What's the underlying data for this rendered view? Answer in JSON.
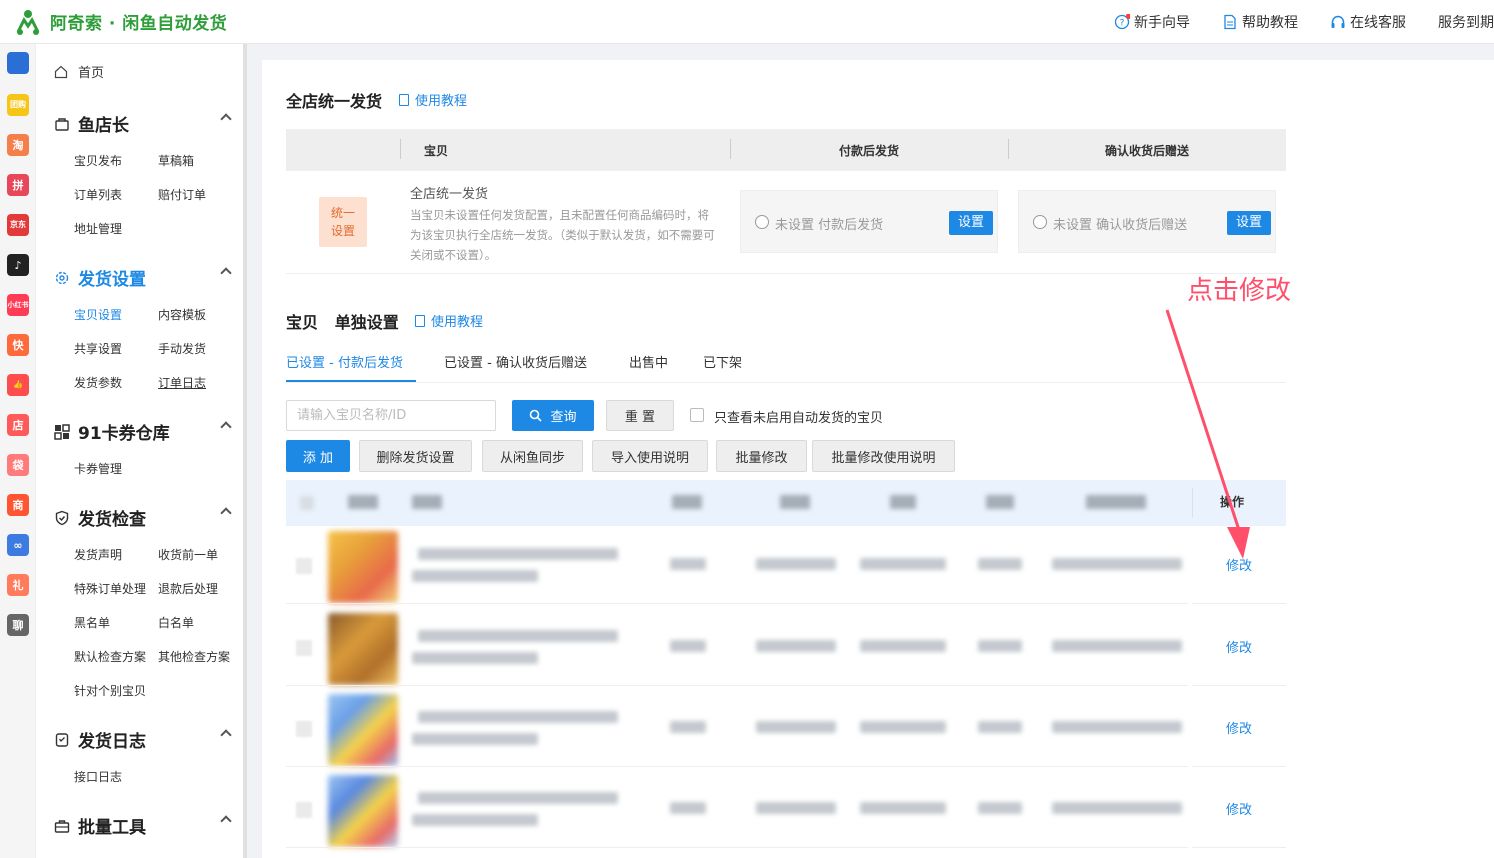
{
  "header": {
    "logo_text": "阿奇索 · 闲鱼自动发货",
    "links": [
      {
        "label": "新手向导",
        "icon": "question-circle-icon"
      },
      {
        "label": "帮助教程",
        "icon": "document-icon"
      },
      {
        "label": "在线客服",
        "icon": "headset-icon"
      },
      {
        "label": "服务到期",
        "icon": ""
      }
    ]
  },
  "app_strip": [
    {
      "name": "grid-app-icon",
      "text": "",
      "color": "#2b6fd6"
    },
    {
      "name": "tuangou-app-icon",
      "text": "团购",
      "color": "#f5c518"
    },
    {
      "name": "taobao-app-icon",
      "text": "淘",
      "color": "#f57f4b"
    },
    {
      "name": "pinduoduo-app-icon",
      "text": "拼",
      "color": "#e8475a"
    },
    {
      "name": "jingdong-app-icon",
      "text": "京东",
      "color": "#e23a3a"
    },
    {
      "name": "douyin-app-icon",
      "text": "♪",
      "color": "#222222"
    },
    {
      "name": "xiaohongshu-app-icon",
      "text": "小红书",
      "color": "#ff3b56"
    },
    {
      "name": "kuaishou-app-icon",
      "text": "快",
      "color": "#ff6a3c"
    },
    {
      "name": "thumb-app-icon",
      "text": "👍",
      "color": "#ff4d4d"
    },
    {
      "name": "dian-app-icon",
      "text": "店",
      "color": "#ff5a5a"
    },
    {
      "name": "bag-app-icon",
      "text": "袋",
      "color": "#ff7a7a"
    },
    {
      "name": "shop-app-icon",
      "text": "商",
      "color": "#ff5533"
    },
    {
      "name": "link-app-icon",
      "text": "∞",
      "color": "#3d7be0"
    },
    {
      "name": "gift-app-icon",
      "text": "礼",
      "color": "#ff7b5c"
    },
    {
      "name": "chat-app-icon",
      "text": "聊",
      "color": "#666666"
    }
  ],
  "sidebar": {
    "home": "首页",
    "sections": [
      {
        "title": "鱼店长",
        "icon": "bag-icon",
        "items": [
          "宝贝发布",
          "草稿箱",
          "订单列表",
          "赔付订单",
          "地址管理"
        ]
      },
      {
        "title": "发货设置",
        "icon": "gear-icon",
        "items": [
          "宝贝设置",
          "内容模板",
          "共享设置",
          "手动发货",
          "发货参数",
          "订单日志"
        ]
      },
      {
        "title": "91卡券仓库",
        "icon": "grid-icon",
        "items": [
          "卡券管理"
        ]
      },
      {
        "title": "发货检查",
        "icon": "shield-icon",
        "items": [
          "发货声明",
          "收货前一单",
          "特殊订单处理",
          "退款后处理",
          "黑名单",
          "白名单",
          "默认检查方案",
          "其他检查方案",
          "针对个别宝贝"
        ]
      },
      {
        "title": "发货日志",
        "icon": "log-icon",
        "items": [
          "接口日志"
        ]
      },
      {
        "title": "批量工具",
        "icon": "toolbox-icon",
        "items": []
      }
    ]
  },
  "global": {
    "title": "全店统一发货",
    "tutorial": "使用教程",
    "columns": [
      "宝贝",
      "付款后发货",
      "确认收货后赠送"
    ],
    "badge": "统一\n设置",
    "item_title": "全店统一发货",
    "item_desc": "当宝贝未设置任何发货配置，且未配置任何商品编码时，将为该宝贝执行全店统一发货。（类似于默认发货，如不需要可关闭或不设置）。",
    "pay_status": "未设置 付款后发货",
    "confirm_status": "未设置 确认收货后赠送",
    "set_label": "设置"
  },
  "single": {
    "title": "宝贝   单独设置",
    "tutorial": "使用教程",
    "tabs": [
      "已设置 - 付款后发货",
      "已设置 - 确认收货后赠送",
      "出售中",
      "已下架"
    ],
    "search_placeholder": "请输入宝贝名称/ID",
    "query_label": "查询",
    "reset_label": "重 置",
    "checkbox_label": "只查看未启用自动发货的宝贝",
    "actions": [
      "添 加",
      "删除发货设置",
      "从闲鱼同步",
      "导入使用说明",
      "批量修改",
      "批量修改使用说明"
    ],
    "op_header": "操作",
    "rows": [
      {
        "edit": "修改"
      },
      {
        "edit": "修改"
      },
      {
        "edit": "修改"
      },
      {
        "edit": "修改"
      }
    ]
  },
  "annotation": {
    "text": "点击修改",
    "color": "#ff4f6b"
  },
  "colors": {
    "accent": "#1e88e5",
    "brand": "#2e9e3a"
  }
}
